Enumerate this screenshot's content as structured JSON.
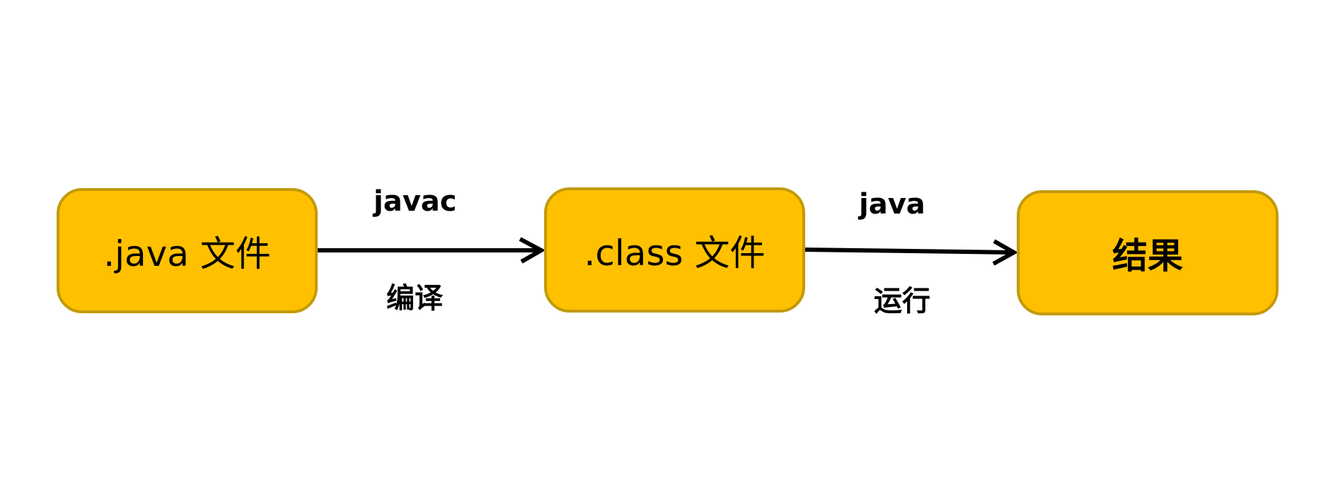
{
  "nodes": {
    "java_file": ".java 文件",
    "class_file": ".class 文件",
    "result": "结果"
  },
  "edges": {
    "compile": {
      "command": "javac",
      "label": "编译"
    },
    "run": {
      "command": "java",
      "label": "运行"
    }
  },
  "colors": {
    "node_fill": "#ffc000",
    "node_border": "#c29a0b",
    "arrow": "#000000"
  }
}
